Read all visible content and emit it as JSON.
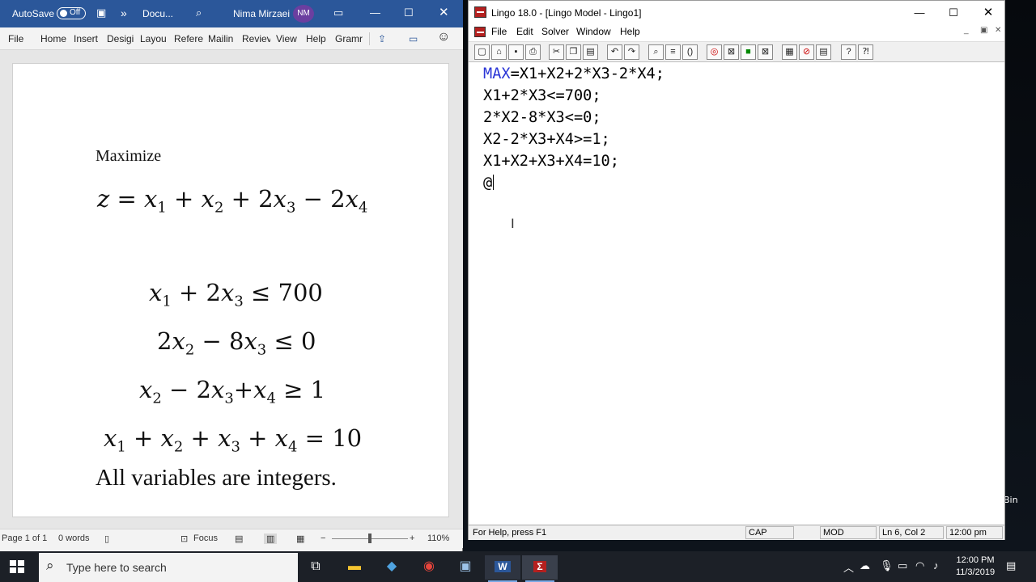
{
  "desktop": {
    "recycle_label": "Bin"
  },
  "word": {
    "titlebar": {
      "autosave_label": "AutoSave",
      "autosave_state": "Off",
      "doc_name": "Docu...",
      "user_name": "Nima Mirzaei",
      "user_initials": "NM",
      "more_glyph": "»"
    },
    "ribbon_tabs": [
      "File",
      "Home",
      "Insert",
      "Desigi",
      "Layou",
      "Refere",
      "Mailin",
      "Reviev",
      "View",
      "Help",
      "Gramr"
    ],
    "document": {
      "heading": "Maximize",
      "objective": {
        "z": "z",
        "x1": "x",
        "s1": "1",
        "x2": "x",
        "s2": "2",
        "x3": "x",
        "s3": "3",
        "x4": "x",
        "s4": "4",
        "coef3": "2",
        "coef4": "2"
      },
      "constraint1_rhs": "700",
      "constraint2_rhs": "0",
      "constraint3_rhs": "1",
      "constraint4_rhs": "10",
      "footer": "All variables are integers."
    },
    "status": {
      "page": "Page 1 of 1",
      "words": "0 words",
      "focus": "Focus",
      "zoom": "110%"
    }
  },
  "lingo": {
    "title": "Lingo 18.0 - [Lingo Model - Lingo1]",
    "menu": [
      "File",
      "Edit",
      "Solver",
      "Window",
      "Help"
    ],
    "code_lines": [
      {
        "kw": "MAX",
        "rest": "=X1+X2+2*X3-2*X4;"
      },
      {
        "kw": "",
        "rest": "X1+2*X3<=700;"
      },
      {
        "kw": "",
        "rest": "2*X2-8*X3<=0;"
      },
      {
        "kw": "",
        "rest": "X2-2*X3+X4>=1;"
      },
      {
        "kw": "",
        "rest": "X1+X2+X3+X4=10;"
      },
      {
        "kw": "",
        "rest": "@"
      }
    ],
    "status": {
      "help": "For Help, press F1",
      "cap": "CAP",
      "mod": "MOD",
      "position": "Ln 6, Col 2",
      "time": "12:00 pm"
    }
  },
  "taskbar": {
    "search_placeholder": "Type here to search",
    "clock_time": "12:00 PM",
    "clock_date": "11/3/2019"
  }
}
